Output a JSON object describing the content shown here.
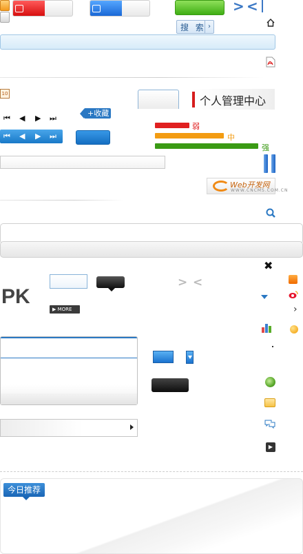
{
  "search": {
    "label": "搜 索"
  },
  "panel_title": "个人管理中心",
  "favorite": {
    "label": "+收藏"
  },
  "password_strength": {
    "weak": "弱",
    "medium": "中",
    "strong": "强",
    "colors": {
      "weak": "#e02020",
      "medium": "#f39c12",
      "strong": "#3a9a14"
    }
  },
  "site_logo": {
    "name": "Web开发网",
    "domain": "WWW.CNCMS.COM.CN"
  },
  "pk_label": "PK",
  "more_button": {
    "label": "▶ MORE"
  },
  "today_recommend": "今日推荐",
  "calendar_day": "10",
  "icons": {
    "home": "home-icon",
    "pdf": "pdf-icon",
    "search": "search-icon",
    "close": "close-icon",
    "rss": "rss-icon",
    "weibo": "weibo-icon",
    "chart": "chart-icon",
    "globe": "globe-icon",
    "folder": "folder-star-icon",
    "chat": "chat-icon",
    "play": "play-icon"
  },
  "accent_colors": {
    "blue": "#2a78c3",
    "green": "#3fae14",
    "red": "#d61d1d"
  }
}
